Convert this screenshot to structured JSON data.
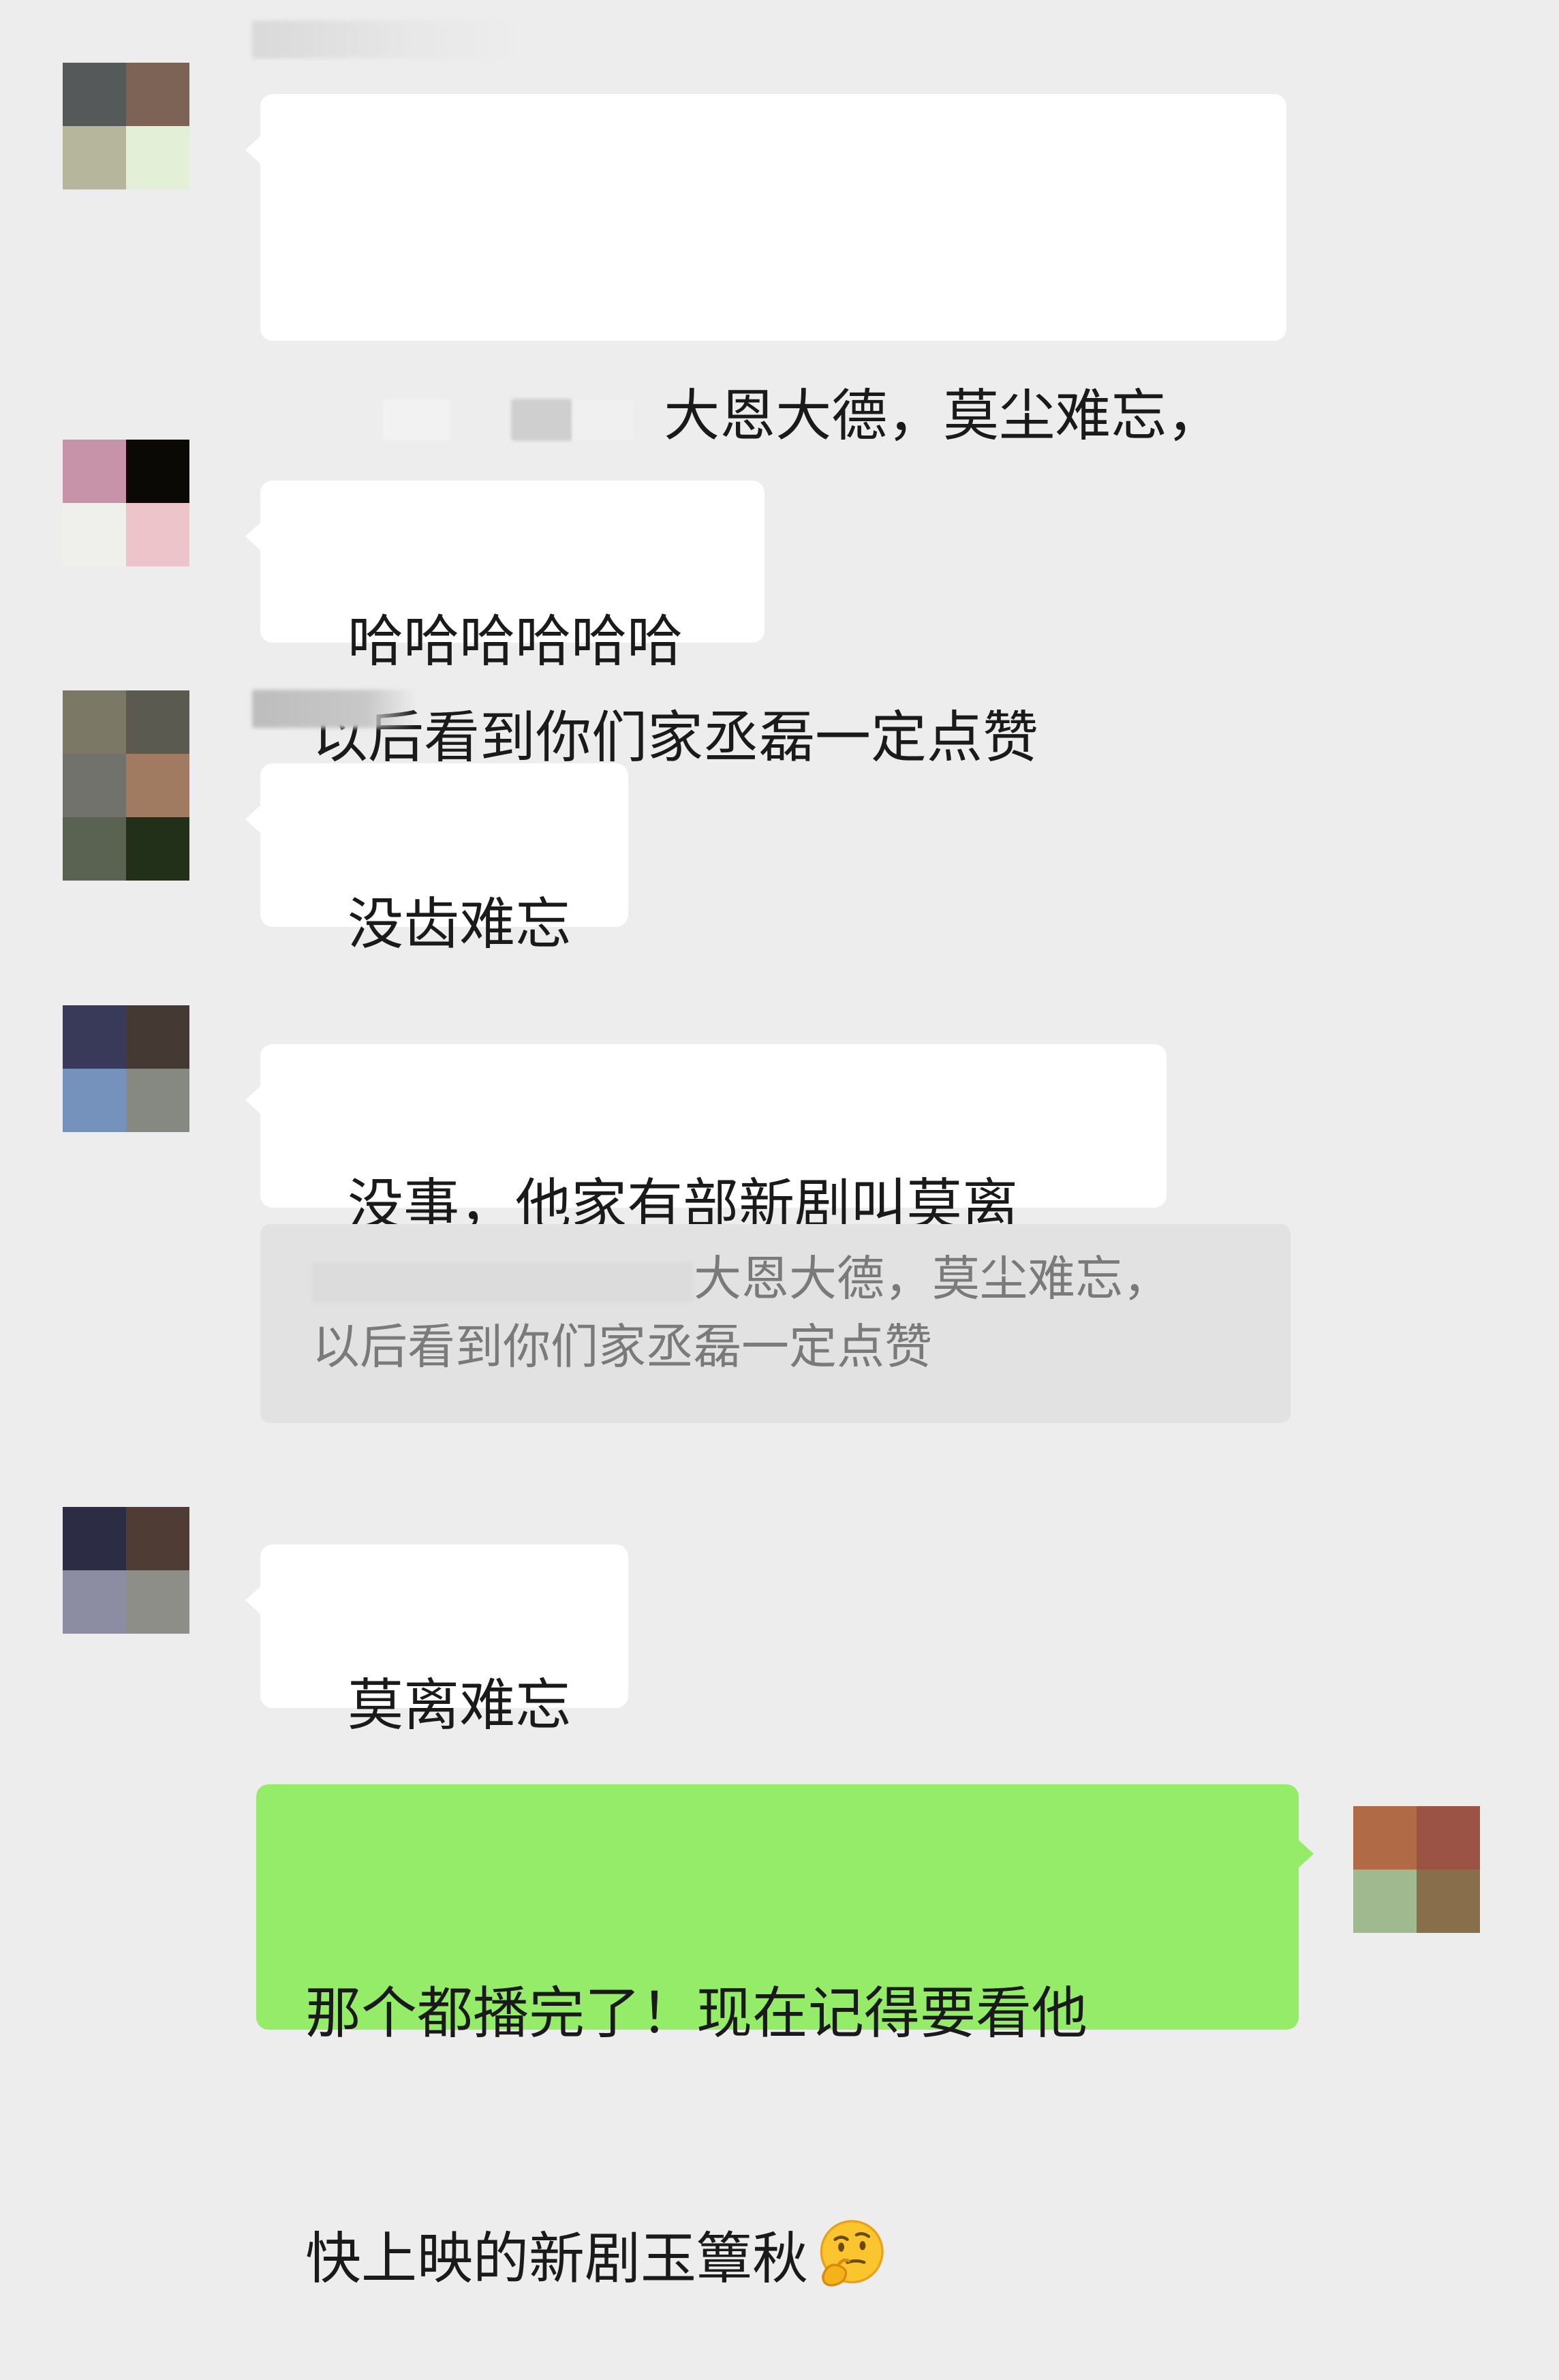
{
  "messages": [
    {
      "id": "m1",
      "line1": "大恩大德，莫尘难忘，",
      "line2": "以后看到你们家丞磊一定点赞"
    },
    {
      "id": "m2",
      "text": "哈哈哈哈哈哈"
    },
    {
      "id": "m3",
      "text": "没齿难忘"
    },
    {
      "id": "m4",
      "text": "没事，他家有部新剧叫莫离",
      "quote_line1": "大恩大德，莫尘难忘，",
      "quote_line2": "以后看到你们家丞磊一定点赞"
    },
    {
      "id": "m5",
      "text": "莫离难忘"
    },
    {
      "id": "m6",
      "line1": "那个都播完了！现在记得要看他",
      "line2": "快上映的新剧玉簟秋",
      "emoji": "thinking-face-emoji"
    }
  ],
  "colors": {
    "background": "#ededed",
    "bubble_incoming": "#ffffff",
    "bubble_outgoing": "#95ec69",
    "quote_bg": "#e2e2e2"
  },
  "avatars": {
    "a1": [
      "#55595a",
      "#7c6356",
      "#b6b69c",
      "#e3efd6"
    ],
    "a2": [
      "#c693a8",
      "#0b0906",
      "#eff0eb",
      "#edc4c9"
    ],
    "a3": [
      "#7b7865",
      "#5b5a50",
      "#72726c",
      "#a07a61",
      "#5a6252",
      "#223019"
    ],
    "a4": [
      "#39395a",
      "#453a33",
      "#7492bb",
      "#868882"
    ],
    "a5": [
      "#2c2c45",
      "#4f3d35",
      "#8c8ca2",
      "#8d8e87"
    ],
    "a6": [
      "#b06b46",
      "#9a5345",
      "#a1b98e",
      "#896e4c"
    ]
  }
}
